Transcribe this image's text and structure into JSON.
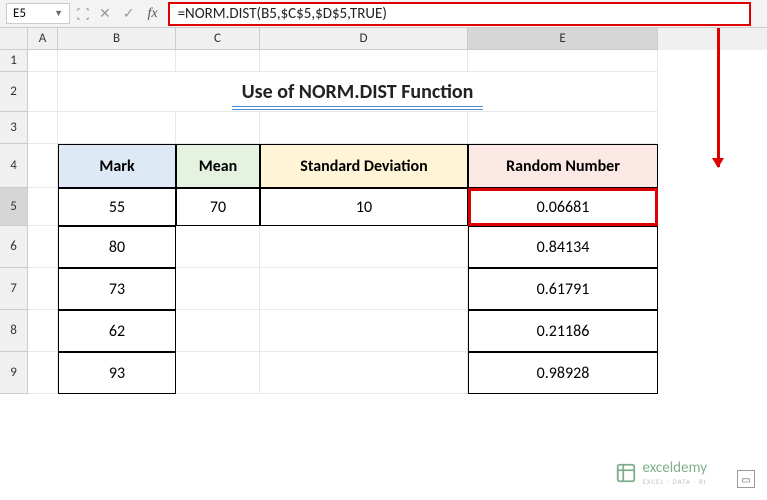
{
  "namebox": {
    "value": "E5"
  },
  "formula_bar": {
    "fx": "fx",
    "formula": "=NORM.DIST(B5,$C$5,$D$5,TRUE)"
  },
  "columns": {
    "A": "A",
    "B": "B",
    "C": "C",
    "D": "D",
    "E": "E"
  },
  "rows": {
    "r1": "1",
    "r2": "2",
    "r3": "3",
    "r4": "4",
    "r5": "5",
    "r6": "6",
    "r7": "7",
    "r8": "8",
    "r9": "9"
  },
  "title": "Use of NORM.DIST Function",
  "headers": {
    "mark": "Mark",
    "mean": "Mean",
    "std": "Standard Deviation",
    "rand": "Random Number"
  },
  "data": {
    "mark": [
      "55",
      "80",
      "73",
      "62",
      "93"
    ],
    "mean": "70",
    "std": "10",
    "random": [
      "0.06681",
      "0.84134",
      "0.61791",
      "0.21186",
      "0.98928"
    ]
  },
  "watermark": {
    "name": "exceldemy",
    "tag": "EXCEL · DATA · BI"
  },
  "chart_data": {
    "type": "table",
    "title": "Use of NORM.DIST Function",
    "columns": [
      "Mark",
      "Mean",
      "Standard Deviation",
      "Random Number"
    ],
    "rows": [
      [
        55,
        70,
        10,
        0.06681
      ],
      [
        80,
        null,
        null,
        0.84134
      ],
      [
        73,
        null,
        null,
        0.61791
      ],
      [
        62,
        null,
        null,
        0.21186
      ],
      [
        93,
        null,
        null,
        0.98928
      ]
    ],
    "formula": "=NORM.DIST(B5,$C$5,$D$5,TRUE)"
  }
}
